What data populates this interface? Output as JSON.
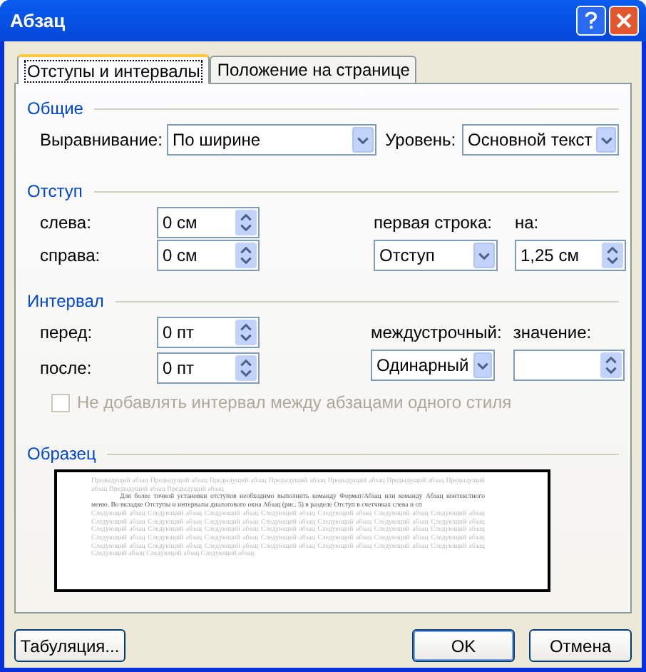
{
  "window": {
    "title": "Абзац"
  },
  "tabs": [
    {
      "label": "Отступы и интервалы",
      "selected": true
    },
    {
      "label": "Положение на странице",
      "selected": false
    }
  ],
  "general": {
    "heading": "Общие",
    "alignment": {
      "label": "Выравнивание:",
      "value": "По ширине"
    },
    "level": {
      "label": "Уровень:",
      "value": "Основной текст"
    }
  },
  "indent": {
    "heading": "Отступ",
    "left": {
      "label": "слева:",
      "value": "0 см"
    },
    "right": {
      "label": "справа:",
      "value": "0 см"
    },
    "first_line": {
      "label": "первая строка:",
      "value": "Отступ"
    },
    "by": {
      "label": "на:",
      "value": "1,25 см"
    }
  },
  "spacing": {
    "heading": "Интервал",
    "before": {
      "label": "перед:",
      "value": "0 пт"
    },
    "after": {
      "label": "после:",
      "value": "0 пт"
    },
    "line_spacing": {
      "label": "междустрочный:",
      "value": "Одинарный"
    },
    "at": {
      "label": "значение:"
    }
  },
  "same_style_checkbox": {
    "label": "Не добавлять интервал между абзацами одного стиля",
    "checked": false,
    "disabled": true
  },
  "preview": {
    "heading": "Образец",
    "previous_text": "Предыдущий абзац Предыдущий абзац Предыдущий абзац Предыдущий абзац Предыдущий абзац Предыдущий абзац Предыдущий абзац Предыдущий абзац Предыдущий абзац",
    "text": "Для более точной установки отступов необходимо выполнить команду Формат/Абзац или команду Абзац контекстного меню. Во вкладке Отступы и интервалы диалогового окна Абзац (рис. 5) в разделе Отступ в счетчиках слева и сп",
    "next_text": "Следующий абзац Следующий абзац Следующий абзац Следующий абзац Следующий абзац Следующий абзац Следующий абзац Следующий абзац Следующий абзац Следующий абзац Следующий абзац Следующий абзац Следующий абзац Следующий абзац Следующий абзац Следующий абзац Следующий абзац Следующий абзац Следующий абзац Следующий абзац Следующий абзац Следующий абзац Следующий абзац Следующий абзац Следующий абзац Следующий абзац Следующий абзац Следующий абзац Следующий абзац Следующий абзац Следующий абзац Следующий абзац Следующий абзац Следующий абзац Следующий абзац Следующий абзац Следующий абзац Следующий абзац"
  },
  "buttons": [
    {
      "label": "Табуляция...",
      "kind": "plain"
    },
    {
      "label": "OK",
      "kind": "default"
    },
    {
      "label": "Отмена",
      "kind": "plain"
    }
  ]
}
